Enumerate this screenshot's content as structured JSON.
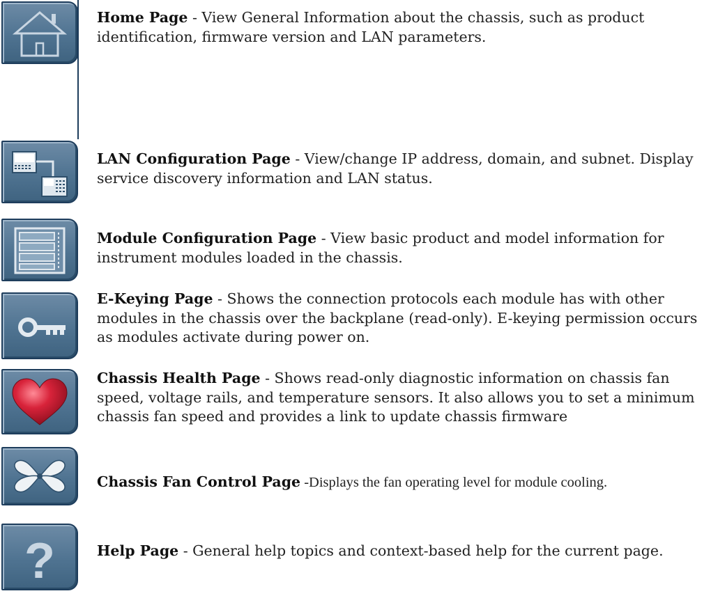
{
  "entries": [
    {
      "title": "Home Page",
      "desc": " - View General Information about the chassis, such as product identification, firmware version and LAN parameters.",
      "icon": "home-icon"
    },
    {
      "title": "LAN Configuration Page",
      "desc": " - View/change IP address, domain, and subnet. Display service discovery information and LAN status.",
      "icon": "network-icon"
    },
    {
      "title": "Module Configuration Page",
      "desc": " - View basic product and model information for instrument modules loaded in the chassis.",
      "icon": "module-rack-icon"
    },
    {
      "title": "E-Keying Page",
      "desc": " - Shows the connection protocols each module has with other modules in the chassis over the backplane (read-only). E-keying permission occurs as modules activate during power on.",
      "icon": "key-icon"
    },
    {
      "title": "Chassis Health Page",
      "desc": " - Shows read-only diagnostic information on chassis fan speed, voltage rails, and temperature sensors. It also allows you to set a minimum chassis fan speed and provides a link to update chassis firmware",
      "icon": "heart-icon"
    },
    {
      "title": "Chassis Fan Control Page",
      "desc": " -Displays the fan operating level for module cooling.",
      "icon": "fan-icon"
    },
    {
      "title": "Help Page",
      "desc": " - General help topics and context-based help for the current page.",
      "icon": "help-icon"
    }
  ],
  "colors": {
    "button_light": "#6d8ba6",
    "button_dark": "#3f6380",
    "button_border": "#1e3d5c",
    "heart": "#d8233a"
  }
}
